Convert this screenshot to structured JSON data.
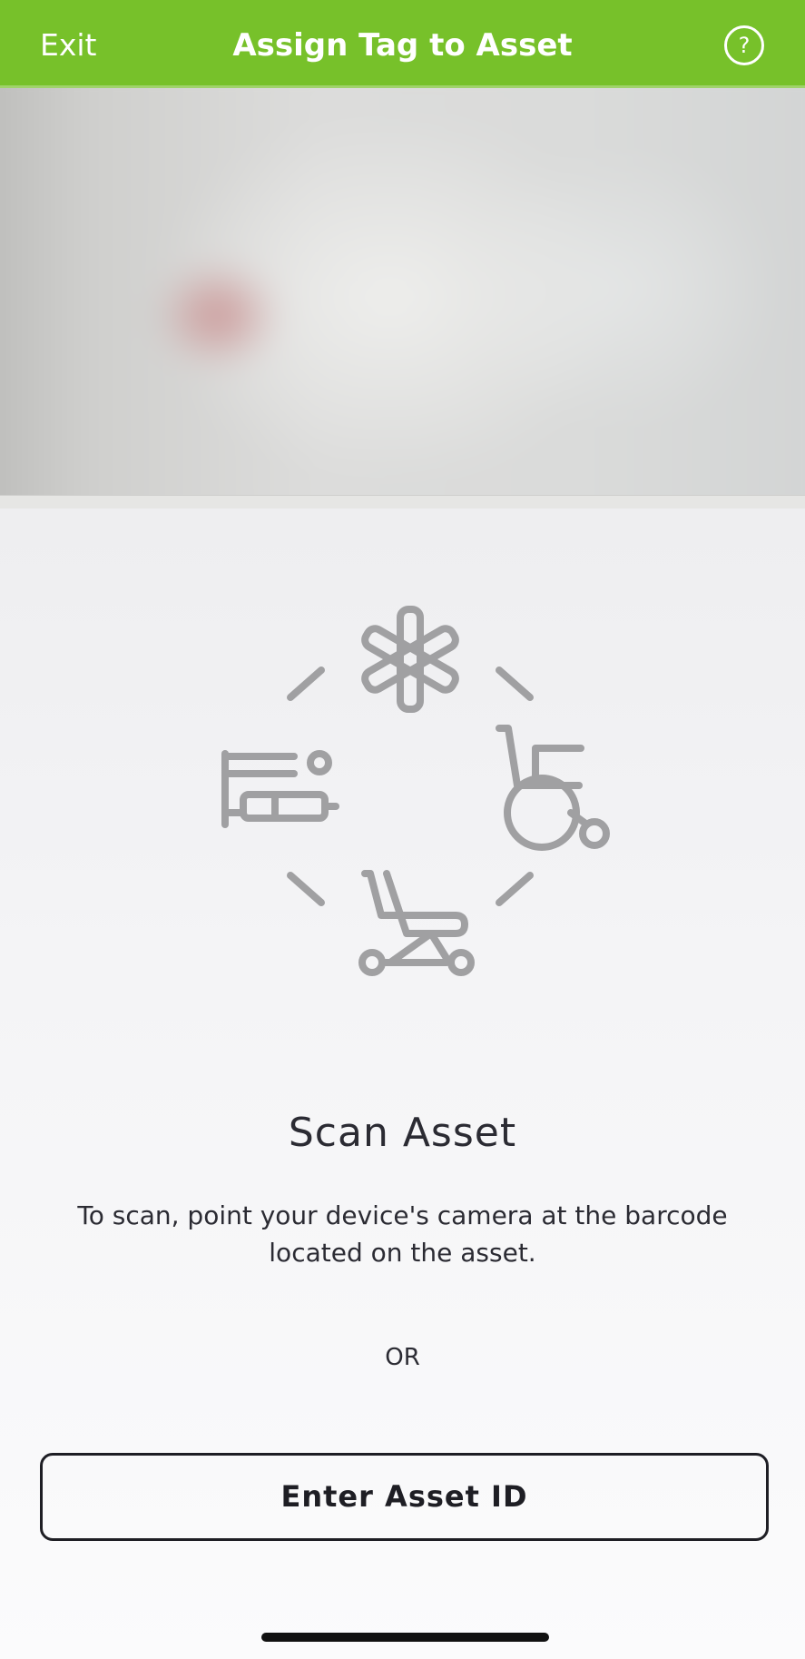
{
  "header": {
    "exit_label": "Exit",
    "title": "Assign Tag to Asset",
    "help_glyph": "?",
    "background_color": "#77c12a"
  },
  "camera_preview": {
    "icon": "blurred-camera-feed"
  },
  "illustration": {
    "icons": [
      "medical-star-icon",
      "wheelchair-icon",
      "stretcher-icon",
      "iv-pump-icon"
    ],
    "icon_color": "#a0a0a2"
  },
  "scan": {
    "title": "Scan Asset",
    "description": "To scan, point your device's camera at the barcode located on the asset.",
    "or_label": "OR"
  },
  "actions": {
    "enter_asset_id_label": "Enter Asset ID"
  }
}
